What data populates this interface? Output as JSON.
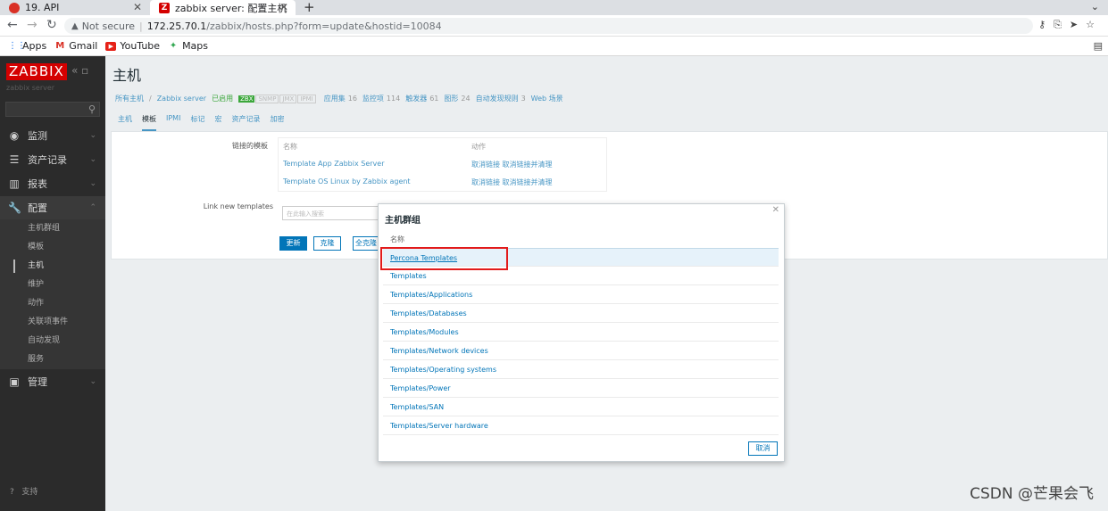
{
  "browser": {
    "tabs": [
      {
        "title": "19. API"
      },
      {
        "title": "zabbix server: 配置主机"
      }
    ],
    "url": {
      "security": "Not secure",
      "host": "172.25.70.1",
      "path": "/zabbix/hosts.php?form=update&hostid=10084"
    },
    "bookmarks": [
      "Apps",
      "Gmail",
      "YouTube",
      "Maps"
    ]
  },
  "sidebar": {
    "logo": "ZABBIX",
    "server": "zabbix server",
    "menu": [
      {
        "label": "监测"
      },
      {
        "label": "资产记录"
      },
      {
        "label": "报表"
      },
      {
        "label": "配置"
      },
      {
        "label": "管理"
      }
    ],
    "submenu": [
      "主机群组",
      "模板",
      "主机",
      "维护",
      "动作",
      "关联项事件",
      "自动发现",
      "服务"
    ],
    "support": "支持"
  },
  "page": {
    "title": "主机",
    "breadcrumb": {
      "all_hosts": "所有主机",
      "host": "Zabbix server",
      "enabled": "已启用",
      "zbx": "ZBX",
      "snmp": "SNMP",
      "jmx": "JMX",
      "ipmi": "IPMI",
      "apps": "应用集",
      "apps_count": "16",
      "items": "监控项",
      "items_count": "114",
      "triggers": "触发器",
      "triggers_count": "61",
      "graphs": "图形",
      "graphs_count": "24",
      "discovery": "自动发现规则",
      "discovery_count": "3",
      "web": "Web 场景"
    },
    "tabs": [
      "主机",
      "模板",
      "IPMI",
      "标记",
      "宏",
      "资产记录",
      "加密"
    ],
    "linked_label": "链接的模板",
    "col_name": "名称",
    "col_action": "动作",
    "linked": [
      {
        "name": "Template App Zabbix Server",
        "unlink": "取消链接",
        "unlink_clear": "取消链接并清理"
      },
      {
        "name": "Template OS Linux by Zabbix agent",
        "unlink": "取消链接",
        "unlink_clear": "取消链接并清理"
      }
    ],
    "link_new_label": "Link new templates",
    "search_placeholder": "在此输入搜索",
    "buttons": {
      "update": "更新",
      "clone": "克隆",
      "full_clone": "全克隆"
    }
  },
  "modal": {
    "title": "主机群组",
    "col": "名称",
    "items": [
      "Percona Templates",
      "Templates",
      "Templates/Applications",
      "Templates/Databases",
      "Templates/Modules",
      "Templates/Network devices",
      "Templates/Operating systems",
      "Templates/Power",
      "Templates/SAN",
      "Templates/Server hardware"
    ],
    "cancel": "取消"
  },
  "watermark": "CSDN @芒果会飞",
  "colors": {
    "brand": "#d40000",
    "link": "#0275b8",
    "highlight": "#e21b1b",
    "sidebar": "#2b2b2b"
  }
}
